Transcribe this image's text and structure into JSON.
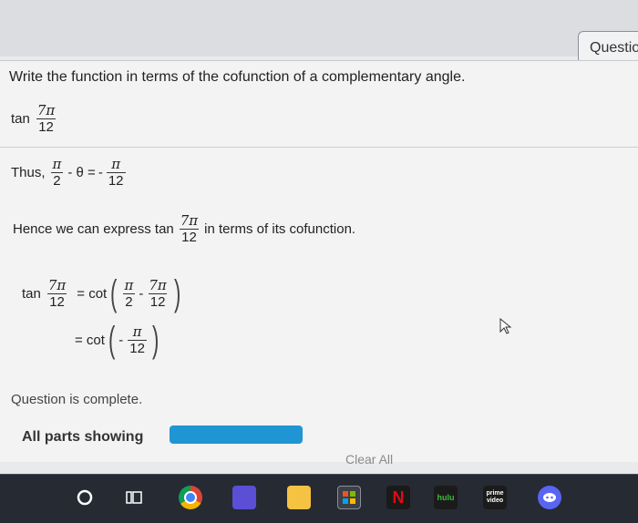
{
  "header": {
    "question_tab": "Questio"
  },
  "problem": {
    "prompt": "Write the function in terms of the cofunction of a complementary angle.",
    "given": {
      "func": "tan",
      "num": "7π",
      "den": "12"
    }
  },
  "thus": {
    "label": "Thus,",
    "pi": "π",
    "two": "2",
    "minus_theta": "- θ =",
    "minus": "-",
    "twelve": "12"
  },
  "hence": {
    "text_a": "Hence we can express tan",
    "num": "7π",
    "den": "12",
    "text_b": "in terms of its cofunction."
  },
  "derivation": {
    "line1": {
      "func": "tan",
      "num": "7π",
      "den": "12",
      "eq": "= cot",
      "inner_pi": "π",
      "inner_two": "2",
      "minus": "-",
      "inner_num": "7π",
      "inner_den": "12"
    },
    "line2": {
      "eq": "= cot",
      "minus": "-",
      "num": "π",
      "den": "12"
    }
  },
  "status": "Question is complete.",
  "parts": {
    "label": "All parts showing"
  },
  "clear_all": "Clear All",
  "taskbar": {
    "items": [
      "start-circle",
      "task-view",
      "chrome",
      "app-purple",
      "file-explorer",
      "store",
      "netflix",
      "hulu",
      "prime-video",
      "discord"
    ],
    "netflix_label": "N",
    "hulu_label": "hulu",
    "prime_label": "prime video",
    "colors": {
      "bar": "#262a33",
      "accent": "#1f96d3"
    }
  }
}
